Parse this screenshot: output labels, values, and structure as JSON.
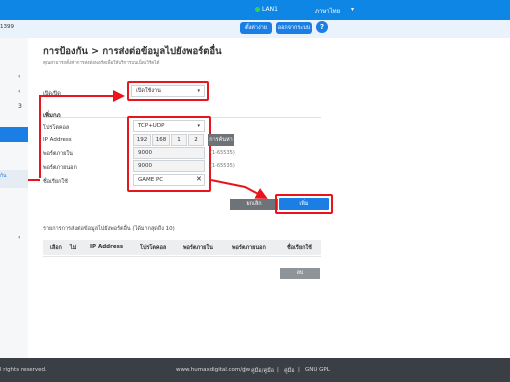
{
  "header": {
    "status_label": "LAN1",
    "language": "ภาษาไทย",
    "language_caret": "▾",
    "btn_settings": "ตั้งค่าง่าย",
    "btn_logout": "ออกจากระบบ",
    "help_label": "?",
    "model_fragment": "1399"
  },
  "sidebar": {
    "glyphs": [
      "‹",
      "‹",
      "3",
      "‹"
    ],
    "sub_selected": "ก้น"
  },
  "page": {
    "title": "การป้องกัน > การส่งต่อข้อมูลไปยังพอร์ตอื่น",
    "subtitle": "คุณสามารถตั้งค่าการส่งต่อพอร์ตเพื่อให้บริการบนเน็ตเวิร์คได้"
  },
  "form": {
    "enable_label": "เปิด/ปิด",
    "enable_value": "เปิดใช้งาน",
    "section_add": "เพิ่มกฎ",
    "protocol_label": "โปรโตคอล",
    "protocol_value": "TCP+UDP",
    "ip_label": "IP Address",
    "ip_octets": [
      "192",
      "168",
      "1",
      "2"
    ],
    "lookup_button": "การค้นหา",
    "inner_port_label": "พอร์ตภายใน",
    "inner_port_value": "9000",
    "inner_port_hint": "(1-65535)",
    "outer_port_label": "พอร์ตภายนอก",
    "outer_port_value": "9000",
    "outer_port_hint": "(1-65535)",
    "name_label": "ชื่อเรียกใช้",
    "name_value": "GAME PC",
    "clear_icon": "✕",
    "cancel_button": "ยกเลิก",
    "add_button": "เพิ่ม"
  },
  "list": {
    "heading": "รายการการส่งต่อข้อมูลไปยังพอร์ตอื่น (ได้มากสุดถึง 10)",
    "columns": [
      "เลือก",
      "ไม่",
      "IP Address",
      "โปรโตคอล",
      "พอร์ตภายใน",
      "พอร์ตภายนอก",
      "ชื่อเรียกใช้"
    ],
    "delete_button": "ลบ"
  },
  "footer": {
    "left": "l rights reserved.",
    "url": "www.humaxdigital.com/gw",
    "links": [
      "คู่มือ/คู่มือ",
      "คู่มือ",
      "GNU GPL"
    ],
    "sep": "|"
  },
  "colors": {
    "primary": "#1a7ee5",
    "highlight": "#e8141e",
    "topbar": "#0e86e6"
  }
}
